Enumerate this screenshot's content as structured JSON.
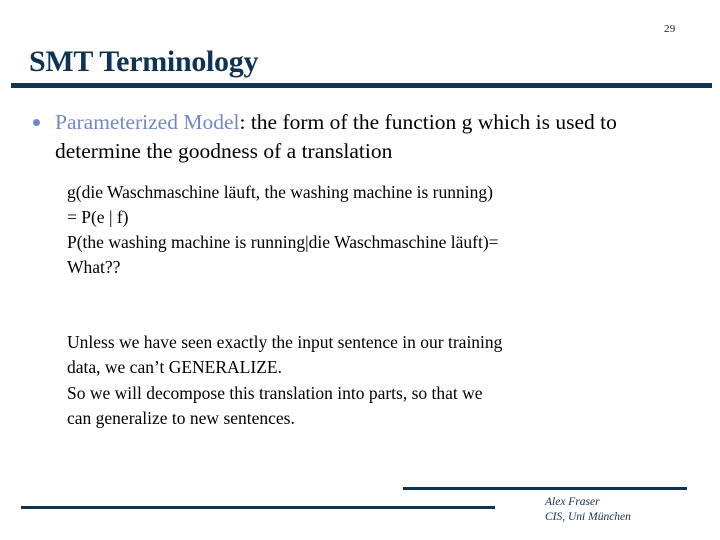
{
  "slide": {
    "page_number": "29",
    "title": "SMT Terminology",
    "accent_color": "#0e3354",
    "highlight_color": "#7189c8"
  },
  "bullet": {
    "marker": "bullet-dot",
    "keyword": "Parameterized Model",
    "rest": ": the form of the function g which is used to determine the goodness of a translation"
  },
  "equations": {
    "line1": "g(die Waschmaschine läuft, the washing machine is running)",
    "line2": "= P(e | f)",
    "line3": "P(the washing machine is running|die Waschmaschine läuft)=",
    "line4": "What??"
  },
  "paragraphs": {
    "p1_line1": "Unless we have seen exactly the input sentence in our training",
    "p1_line2": "data, we can’t GENERALIZE.",
    "p2_line1": "So we will decompose this translation into parts, so that we",
    "p2_line2": "can generalize to new sentences."
  },
  "footer": {
    "author": "Alex Fraser",
    "affiliation": "CIS, Uni München"
  }
}
